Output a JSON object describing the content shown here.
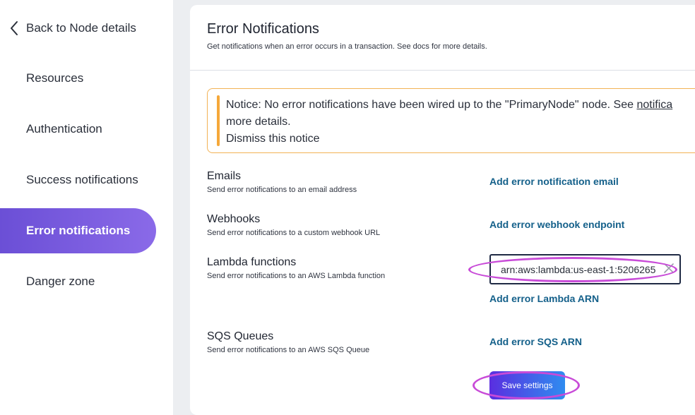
{
  "sidebar": {
    "back_label": "Back to Node details",
    "items": [
      {
        "label": "Resources"
      },
      {
        "label": "Authentication"
      },
      {
        "label": "Success notifications"
      },
      {
        "label": "Error notifications"
      },
      {
        "label": "Danger zone"
      }
    ],
    "active_item": "Error notifications"
  },
  "main": {
    "title": "Error Notifications",
    "subtitle": "Get notifications when an error occurs in a transaction. See docs for more details.",
    "notice": {
      "line1_prefix": "Notice: No error notifications have been wired up to the \"PrimaryNode\" node. See ",
      "link": "notifica",
      "line2": "more details.",
      "dismiss": "Dismiss this notice"
    },
    "sections": {
      "emails": {
        "title": "Emails",
        "desc": "Send error notifications to an email address",
        "action": "Add error notification email"
      },
      "webhooks": {
        "title": "Webhooks",
        "desc": "Send error notifications to a custom webhook URL",
        "action": "Add error webhook endpoint"
      },
      "lambda": {
        "title": "Lambda functions",
        "desc": "Send error notifications to an AWS Lambda function",
        "input_value": "arn:aws:lambda:us-east-1:5206265",
        "action": "Add error Lambda ARN"
      },
      "sqs": {
        "title": "SQS Queues",
        "desc": "Send error notifications to an AWS SQS Queue",
        "action": "Add error SQS ARN"
      }
    },
    "save_label": "Save settings"
  },
  "colors": {
    "accent": "#6b4fd6",
    "link": "#14608a",
    "notice_border": "#f2b255",
    "highlight_oval": "#c84bd8"
  }
}
